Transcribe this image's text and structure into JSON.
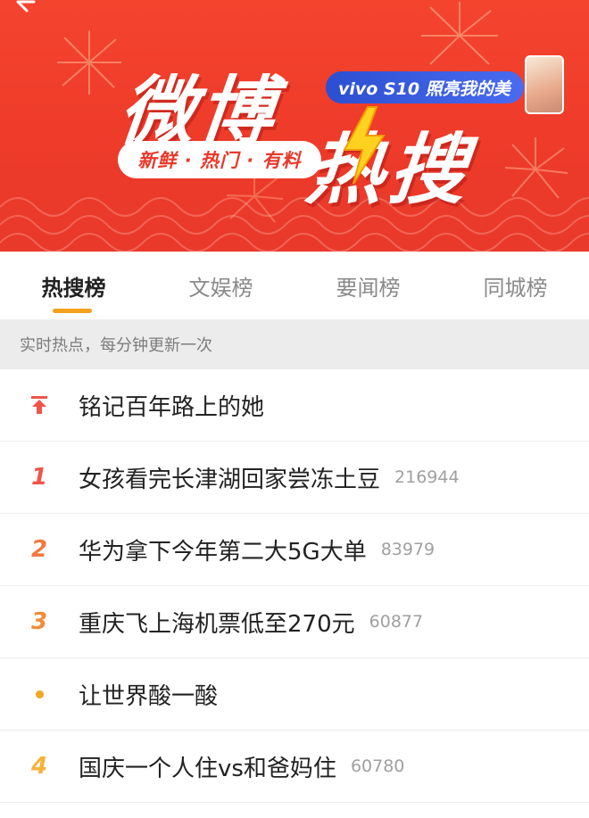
{
  "banner": {
    "title_main": "微博",
    "title_sub": "热搜",
    "slogan": "新鲜 · 热门 · 有料",
    "ad_text": "vivo S10 照亮我的美",
    "brand_color": "#ee3b2a"
  },
  "tabs": [
    {
      "label": "热搜榜",
      "active": true
    },
    {
      "label": "文娱榜",
      "active": false
    },
    {
      "label": "要闻榜",
      "active": false
    },
    {
      "label": "同城榜",
      "active": false
    }
  ],
  "info_bar": {
    "text": "实时热点，每分钟更新一次"
  },
  "list": [
    {
      "rank": "",
      "rank_icon": "pin-top-icon",
      "topic": "铭记百年路上的她",
      "count": ""
    },
    {
      "rank": "1",
      "topic": "女孩看完长津湖回家尝冻土豆",
      "count": "216944"
    },
    {
      "rank": "2",
      "topic": "华为拿下今年第二大5G大单",
      "count": "83979"
    },
    {
      "rank": "3",
      "topic": "重庆飞上海机票低至270元",
      "count": "60877"
    },
    {
      "rank": "",
      "rank_icon": "dot-icon",
      "topic": "让世界酸一酸",
      "count": ""
    },
    {
      "rank": "4",
      "topic": "国庆一个人住vs和爸妈住",
      "count": "60780"
    }
  ],
  "colors": {
    "accent_underline": "#f4a11d",
    "rank_1": "#f0544a",
    "rank_2": "#f2793f",
    "rank_3": "#f38b38",
    "rank_4": "#f7b23a"
  }
}
